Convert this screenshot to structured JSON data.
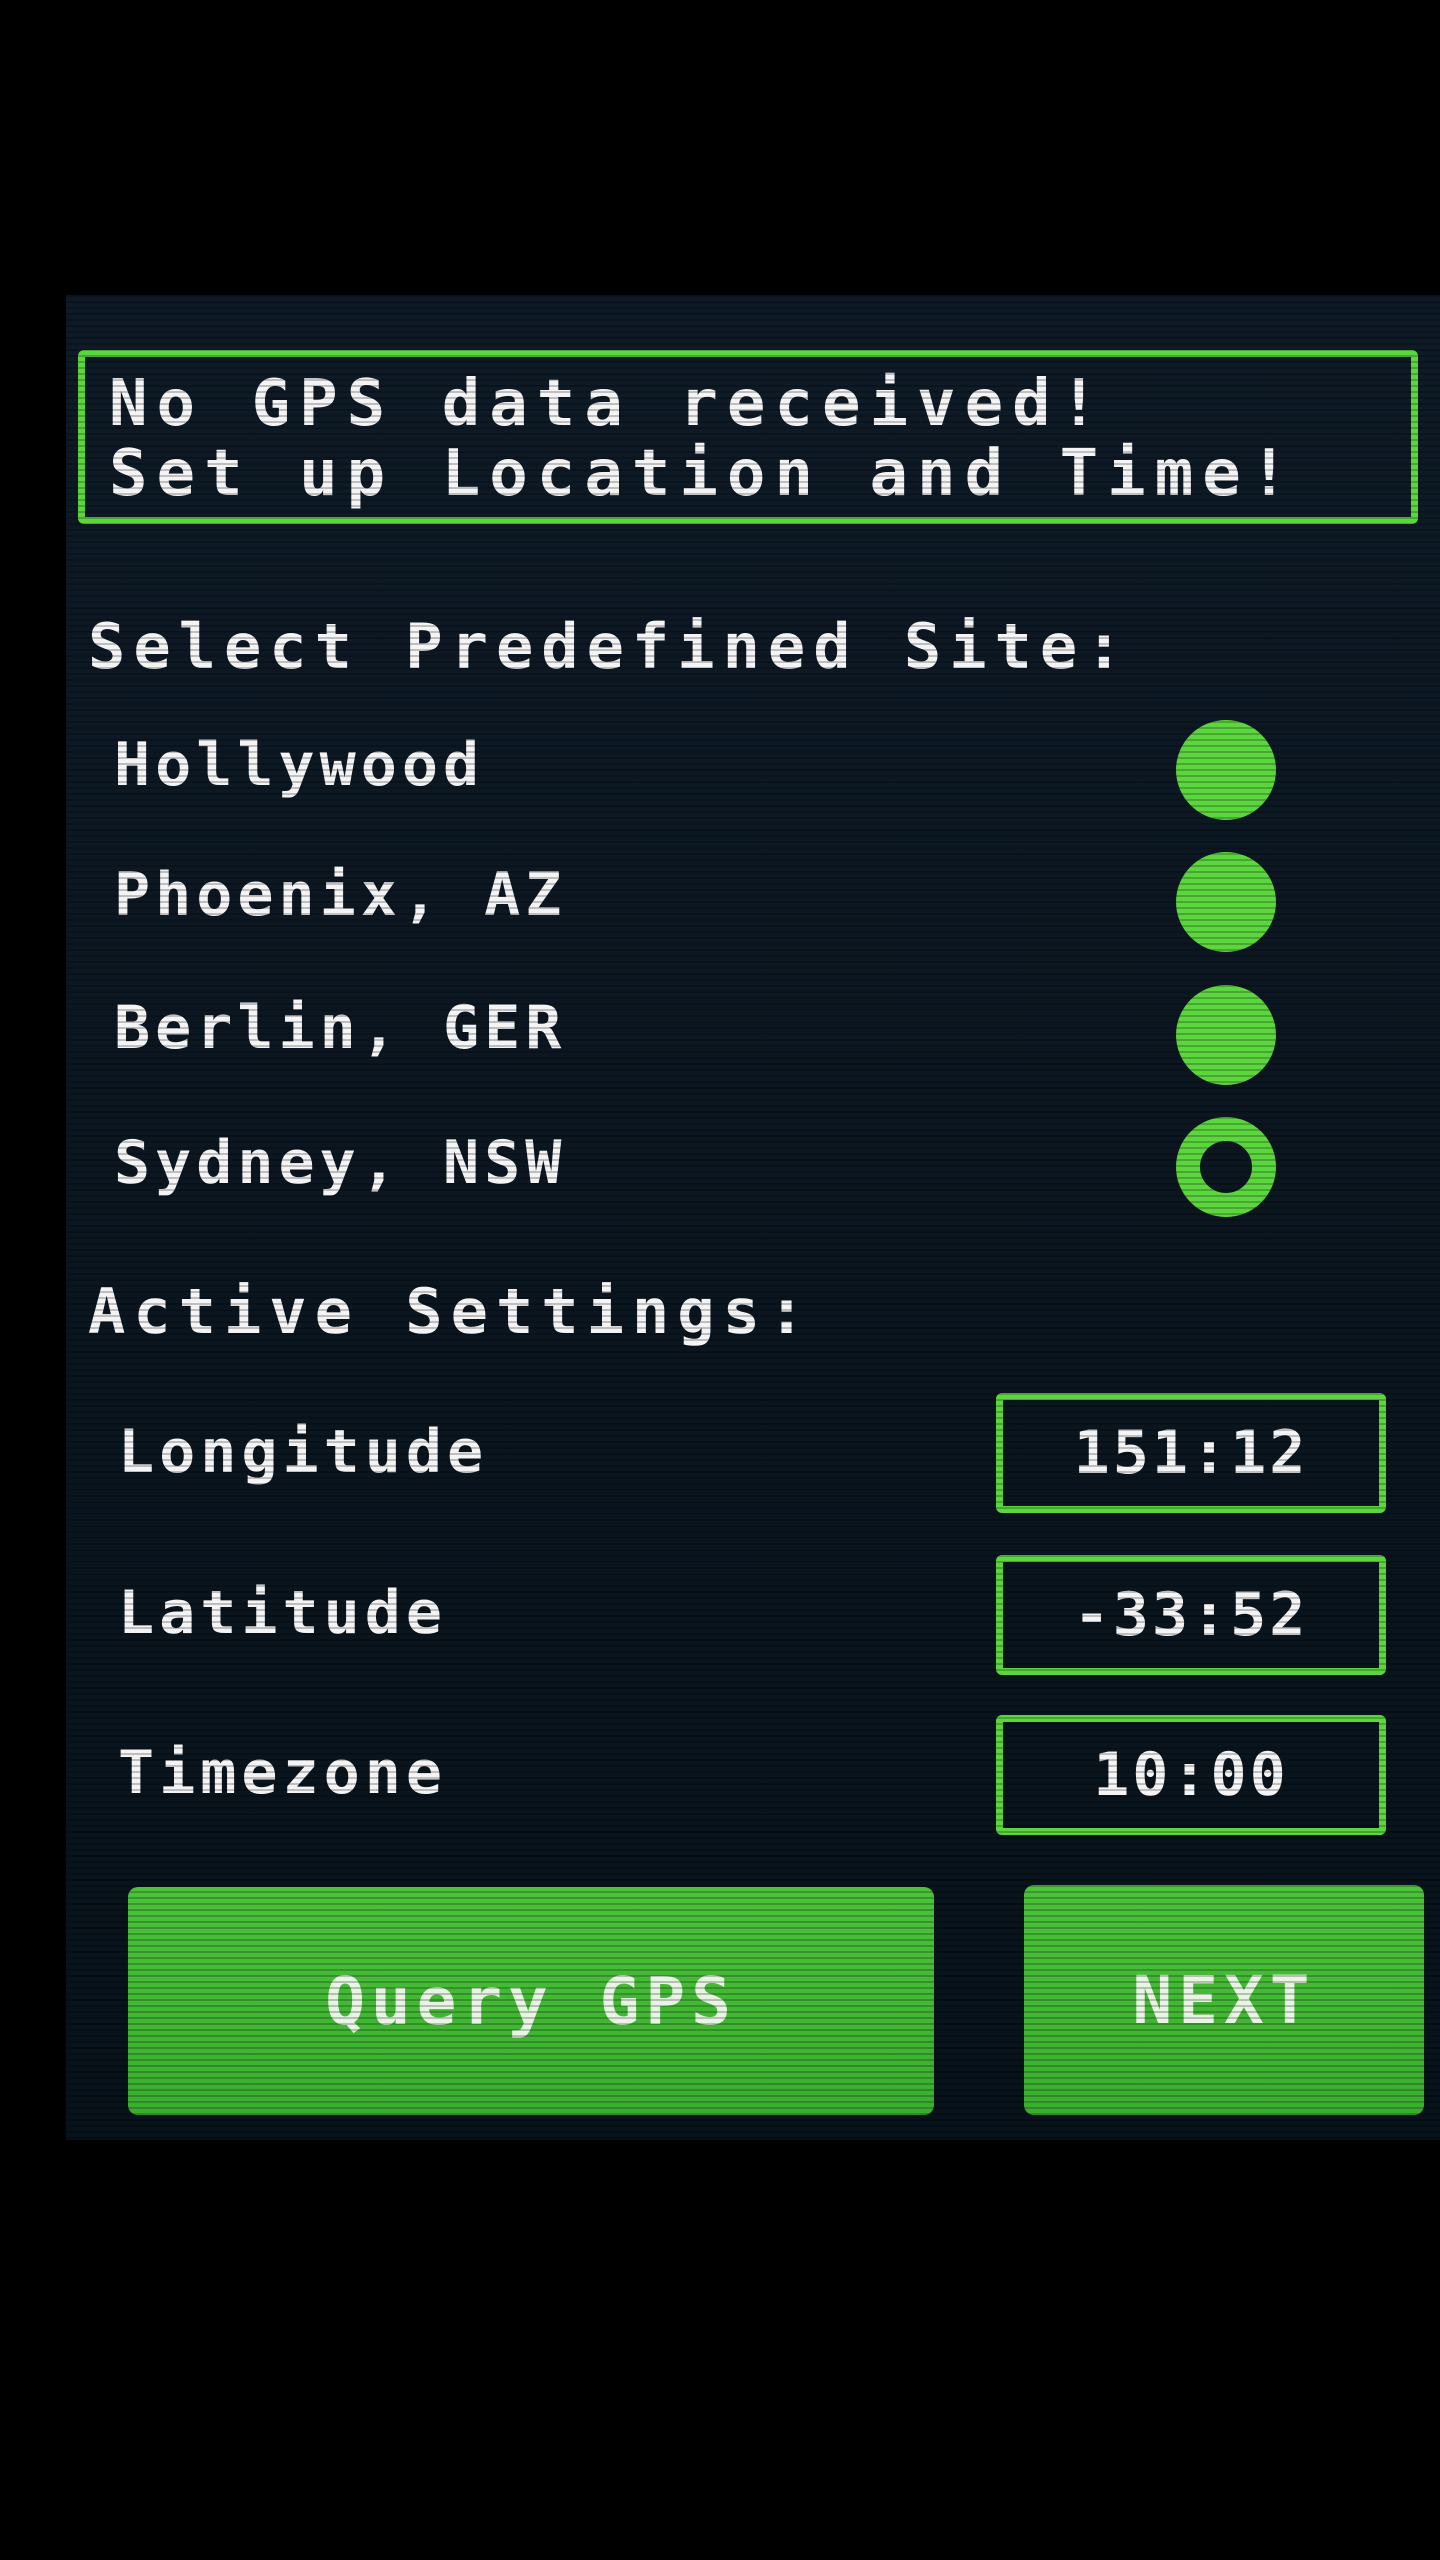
{
  "alert": {
    "line1": "No GPS data received!",
    "line2": "Set up Location and Time!"
  },
  "sites": {
    "heading": "Select Predefined Site:",
    "items": [
      {
        "label": "Hollywood",
        "selected": false
      },
      {
        "label": "Phoenix, AZ",
        "selected": false
      },
      {
        "label": "Berlin, GER",
        "selected": false
      },
      {
        "label": "Sydney, NSW",
        "selected": true
      }
    ]
  },
  "settings": {
    "heading": "Active Settings:",
    "rows": [
      {
        "label": "Longitude",
        "value": "151:12"
      },
      {
        "label": "Latitude",
        "value": "-33:52"
      },
      {
        "label": "Timezone",
        "value": "10:00"
      }
    ]
  },
  "buttons": {
    "query_gps": "Query GPS",
    "next": "NEXT"
  },
  "colors": {
    "accent": "#5cd63f",
    "background": "#0b1620",
    "text": "#f4f4f4"
  }
}
